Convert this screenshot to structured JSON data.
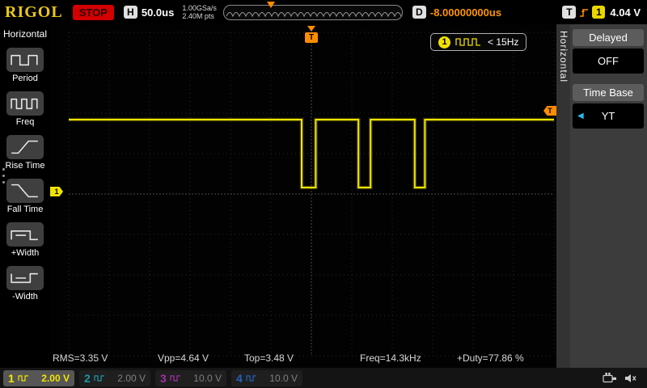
{
  "colors": {
    "ch1": "#f0e500",
    "ch2": "#20b8c8",
    "ch3": "#c838c8",
    "ch4": "#2874e8",
    "trigger": "#ff8c00",
    "brand_gold": "#e8c818",
    "accent_cyan": "#28b8e8"
  },
  "topbar": {
    "brand": "RIGOL",
    "run_state": "STOP",
    "h_label": "H",
    "timebase": "50.0us",
    "sample_rate": "1.00GSa/s",
    "memory_depth": "2.40M pts",
    "delay_label": "D",
    "delay_value": "-8.00000000us",
    "trigger_label": "T",
    "trigger_source": "1",
    "trigger_level": "4.04 V"
  },
  "left_menu": {
    "title": "Horizontal",
    "items": [
      {
        "label": "Period",
        "icon": "period-icon"
      },
      {
        "label": "Freq",
        "icon": "freq-icon"
      },
      {
        "label": "Rise Time",
        "icon": "rise-time-icon"
      },
      {
        "label": "Fall Time",
        "icon": "fall-time-icon"
      },
      {
        "label": "+Width",
        "icon": "plus-width-icon"
      },
      {
        "label": "-Width",
        "icon": "minus-width-icon"
      }
    ]
  },
  "display": {
    "trigger_badge": {
      "channel": "1",
      "text": "< 15Hz"
    },
    "ch1_marker_label": "1",
    "trigger_marker_label": "T",
    "measurements": [
      {
        "text": "RMS=3.35 V"
      },
      {
        "text": "Vpp=4.64 V"
      },
      {
        "text": "Top=3.48 V"
      },
      {
        "text": "Freq=14.3kHz"
      },
      {
        "text": "+Duty=77.86 %"
      }
    ]
  },
  "right_menu": {
    "title": "Horizontal",
    "sections": [
      {
        "label": "Delayed",
        "value": "OFF"
      },
      {
        "label": "Time Base",
        "value": "YT"
      }
    ]
  },
  "bottombar": {
    "channels": [
      {
        "num": "1",
        "scale": "2.00 V",
        "active": true
      },
      {
        "num": "2",
        "scale": "2.00 V",
        "active": false
      },
      {
        "num": "3",
        "scale": "10.0 V",
        "active": false
      },
      {
        "num": "4",
        "scale": "10.0 V",
        "active": false
      }
    ]
  },
  "chart_data": {
    "type": "line",
    "title": "CH1 pulse waveform",
    "x_axis": {
      "timebase": "50.0us/div",
      "divisions": 12
    },
    "y_axis": {
      "scale": "2.00 V/div",
      "divisions": 8
    },
    "high_level_v": 3.48,
    "low_level_v": 0.2,
    "high_frac_y": 0.27,
    "low_frac_y": 0.48,
    "low_pulses_frac_x": [
      [
        0.48,
        0.509
      ],
      [
        0.597,
        0.622
      ],
      [
        0.713,
        0.734
      ]
    ],
    "measurements": {
      "RMS": "3.35 V",
      "Vpp": "4.64 V",
      "Top": "3.48 V",
      "Freq": "14.3kHz",
      "+Duty": "77.86 %"
    }
  }
}
